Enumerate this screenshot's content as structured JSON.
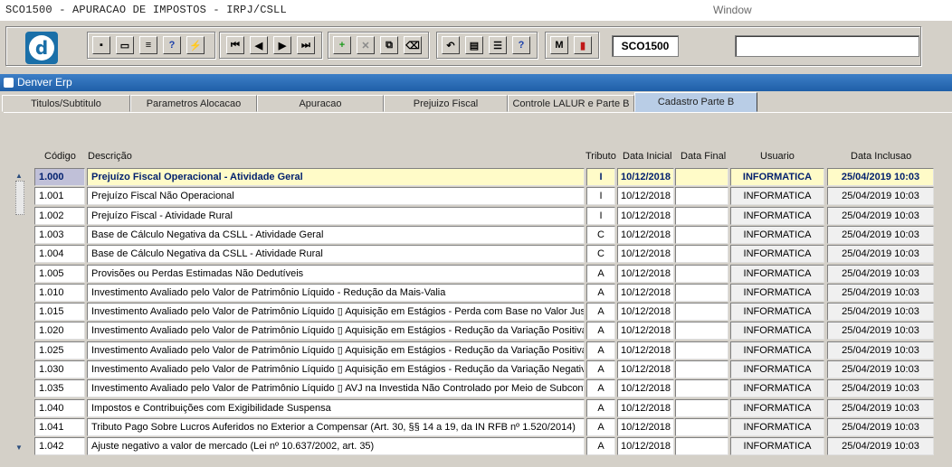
{
  "window": {
    "app_title": "SCO1500 - APURACAO DE IMPOSTOS - IRPJ/CSLL",
    "window_label": "Window"
  },
  "toolbar": {
    "logo_letter": "d",
    "form_code": "SCO1500",
    "buttons": [
      {
        "name": "save-icon",
        "glyph": "▪"
      },
      {
        "name": "print-preview-icon",
        "glyph": "▭"
      },
      {
        "name": "print-icon",
        "glyph": "≡"
      },
      {
        "name": "query-enter-icon",
        "glyph": "?"
      },
      {
        "name": "query-execute-icon",
        "glyph": "⚡"
      },
      {
        "name": "first-record-icon",
        "glyph": "⏮"
      },
      {
        "name": "previous-record-icon",
        "glyph": "◀"
      },
      {
        "name": "next-record-icon",
        "glyph": "▶"
      },
      {
        "name": "last-record-icon",
        "glyph": "⏭"
      },
      {
        "name": "insert-record-icon",
        "glyph": "+"
      },
      {
        "name": "delete-record-icon",
        "glyph": "✕"
      },
      {
        "name": "duplicate-record-icon",
        "glyph": "⧉"
      },
      {
        "name": "clear-record-icon",
        "glyph": "⌫"
      },
      {
        "name": "undo-icon",
        "glyph": "↶"
      },
      {
        "name": "clipboard-icon",
        "glyph": "▤"
      },
      {
        "name": "tools-icon",
        "glyph": "☰"
      },
      {
        "name": "help-icon",
        "glyph": "?"
      },
      {
        "name": "menu-icon",
        "glyph": "M"
      },
      {
        "name": "exit-icon",
        "glyph": "▮"
      }
    ]
  },
  "erp": {
    "title": "Denver Erp"
  },
  "tabs": [
    {
      "label": "Titulos/Subtitulo",
      "active": false
    },
    {
      "label": "Parametros Alocacao",
      "active": false
    },
    {
      "label": "Apuracao",
      "active": false
    },
    {
      "label": "Prejuizo Fiscal",
      "active": false
    },
    {
      "label": "Controle LALUR e Parte B",
      "active": false
    },
    {
      "label": "Cadastro Parte B",
      "active": true
    }
  ],
  "grid": {
    "headers": {
      "codigo": "Código",
      "descricao": "Descrição",
      "tributo": "Tributo",
      "data_inicial": "Data Inicial",
      "data_final": "Data Final",
      "usuario": "Usuario",
      "data_inclusao": "Data Inclusao"
    },
    "rows": [
      {
        "codigo": "1.000",
        "descricao": "Prejuízo Fiscal Operacional - Atividade Geral",
        "tributo": "I",
        "data_inicial": "10/12/2018",
        "data_final": "",
        "usuario": "INFORMATICA",
        "data_inclusao": "25/04/2019 10:03"
      },
      {
        "codigo": "1.001",
        "descricao": "Prejuízo Fiscal Não Operacional",
        "tributo": "I",
        "data_inicial": "10/12/2018",
        "data_final": "",
        "usuario": "INFORMATICA",
        "data_inclusao": "25/04/2019 10:03"
      },
      {
        "codigo": "1.002",
        "descricao": "Prejuízo Fiscal - Atividade Rural",
        "tributo": "I",
        "data_inicial": "10/12/2018",
        "data_final": "",
        "usuario": "INFORMATICA",
        "data_inclusao": "25/04/2019 10:03"
      },
      {
        "codigo": "1.003",
        "descricao": "Base de Cálculo Negativa da CSLL - Atividade Geral",
        "tributo": "C",
        "data_inicial": "10/12/2018",
        "data_final": "",
        "usuario": "INFORMATICA",
        "data_inclusao": "25/04/2019 10:03"
      },
      {
        "codigo": "1.004",
        "descricao": "Base de Cálculo Negativa da CSLL - Atividade Rural",
        "tributo": "C",
        "data_inicial": "10/12/2018",
        "data_final": "",
        "usuario": "INFORMATICA",
        "data_inclusao": "25/04/2019 10:03"
      },
      {
        "codigo": "1.005",
        "descricao": "Provisões ou Perdas Estimadas Não Dedutíveis",
        "tributo": "A",
        "data_inicial": "10/12/2018",
        "data_final": "",
        "usuario": "INFORMATICA",
        "data_inclusao": "25/04/2019 10:03"
      },
      {
        "codigo": "1.010",
        "descricao": "Investimento Avaliado pelo Valor de Patrimônio Líquido - Redução da Mais-Valia",
        "tributo": "A",
        "data_inicial": "10/12/2018",
        "data_final": "",
        "usuario": "INFORMATICA",
        "data_inclusao": "25/04/2019 10:03"
      },
      {
        "codigo": "1.015",
        "descricao": "Investimento Avaliado pelo Valor de Patrimônio Líquido ▯ Aquisição em Estágios - Perda com Base no Valor Justo",
        "tributo": "A",
        "data_inicial": "10/12/2018",
        "data_final": "",
        "usuario": "INFORMATICA",
        "data_inclusao": "25/04/2019 10:03"
      },
      {
        "codigo": "1.020",
        "descricao": "Investimento Avaliado pelo Valor de Patrimônio Líquido ▯ Aquisição em Estágios - Redução da Variação Positiva d",
        "tributo": "A",
        "data_inicial": "10/12/2018",
        "data_final": "",
        "usuario": "INFORMATICA",
        "data_inclusao": "25/04/2019 10:03"
      },
      {
        "codigo": "1.025",
        "descricao": "Investimento Avaliado pelo Valor de Patrimônio Líquido ▯ Aquisição em Estágios - Redução da Variação Positiva d",
        "tributo": "A",
        "data_inicial": "10/12/2018",
        "data_final": "",
        "usuario": "INFORMATICA",
        "data_inclusao": "25/04/2019 10:03"
      },
      {
        "codigo": "1.030",
        "descricao": "Investimento Avaliado pelo Valor de Patrimônio Líquido ▯ Aquisição em Estágios - Redução da Variação Negativa",
        "tributo": "A",
        "data_inicial": "10/12/2018",
        "data_final": "",
        "usuario": "INFORMATICA",
        "data_inclusao": "25/04/2019 10:03"
      },
      {
        "codigo": "1.035",
        "descricao": "Investimento Avaliado pelo Valor de Patrimônio Líquido ▯ AVJ na Investida Não Controlado por Meio de Subconta",
        "tributo": "A",
        "data_inicial": "10/12/2018",
        "data_final": "",
        "usuario": "INFORMATICA",
        "data_inclusao": "25/04/2019 10:03"
      },
      {
        "codigo": "1.040",
        "descricao": "Impostos e Contribuições com Exigibilidade Suspensa",
        "tributo": "A",
        "data_inicial": "10/12/2018",
        "data_final": "",
        "usuario": "INFORMATICA",
        "data_inclusao": "25/04/2019 10:03"
      },
      {
        "codigo": "1.041",
        "descricao": "Tributo Pago Sobre Lucros Auferidos no Exterior a Compensar (Art. 30, §§ 14 a 19, da IN RFB nº 1.520/2014)",
        "tributo": "A",
        "data_inicial": "10/12/2018",
        "data_final": "",
        "usuario": "INFORMATICA",
        "data_inclusao": "25/04/2019 10:03"
      },
      {
        "codigo": "1.042",
        "descricao": "Ajuste negativo a valor de mercado (Lei nº 10.637/2002, art. 35)",
        "tributo": "A",
        "data_inicial": "10/12/2018",
        "data_final": "",
        "usuario": "INFORMATICA",
        "data_inclusao": "25/04/2019 10:03"
      }
    ],
    "selected_index": 0
  }
}
